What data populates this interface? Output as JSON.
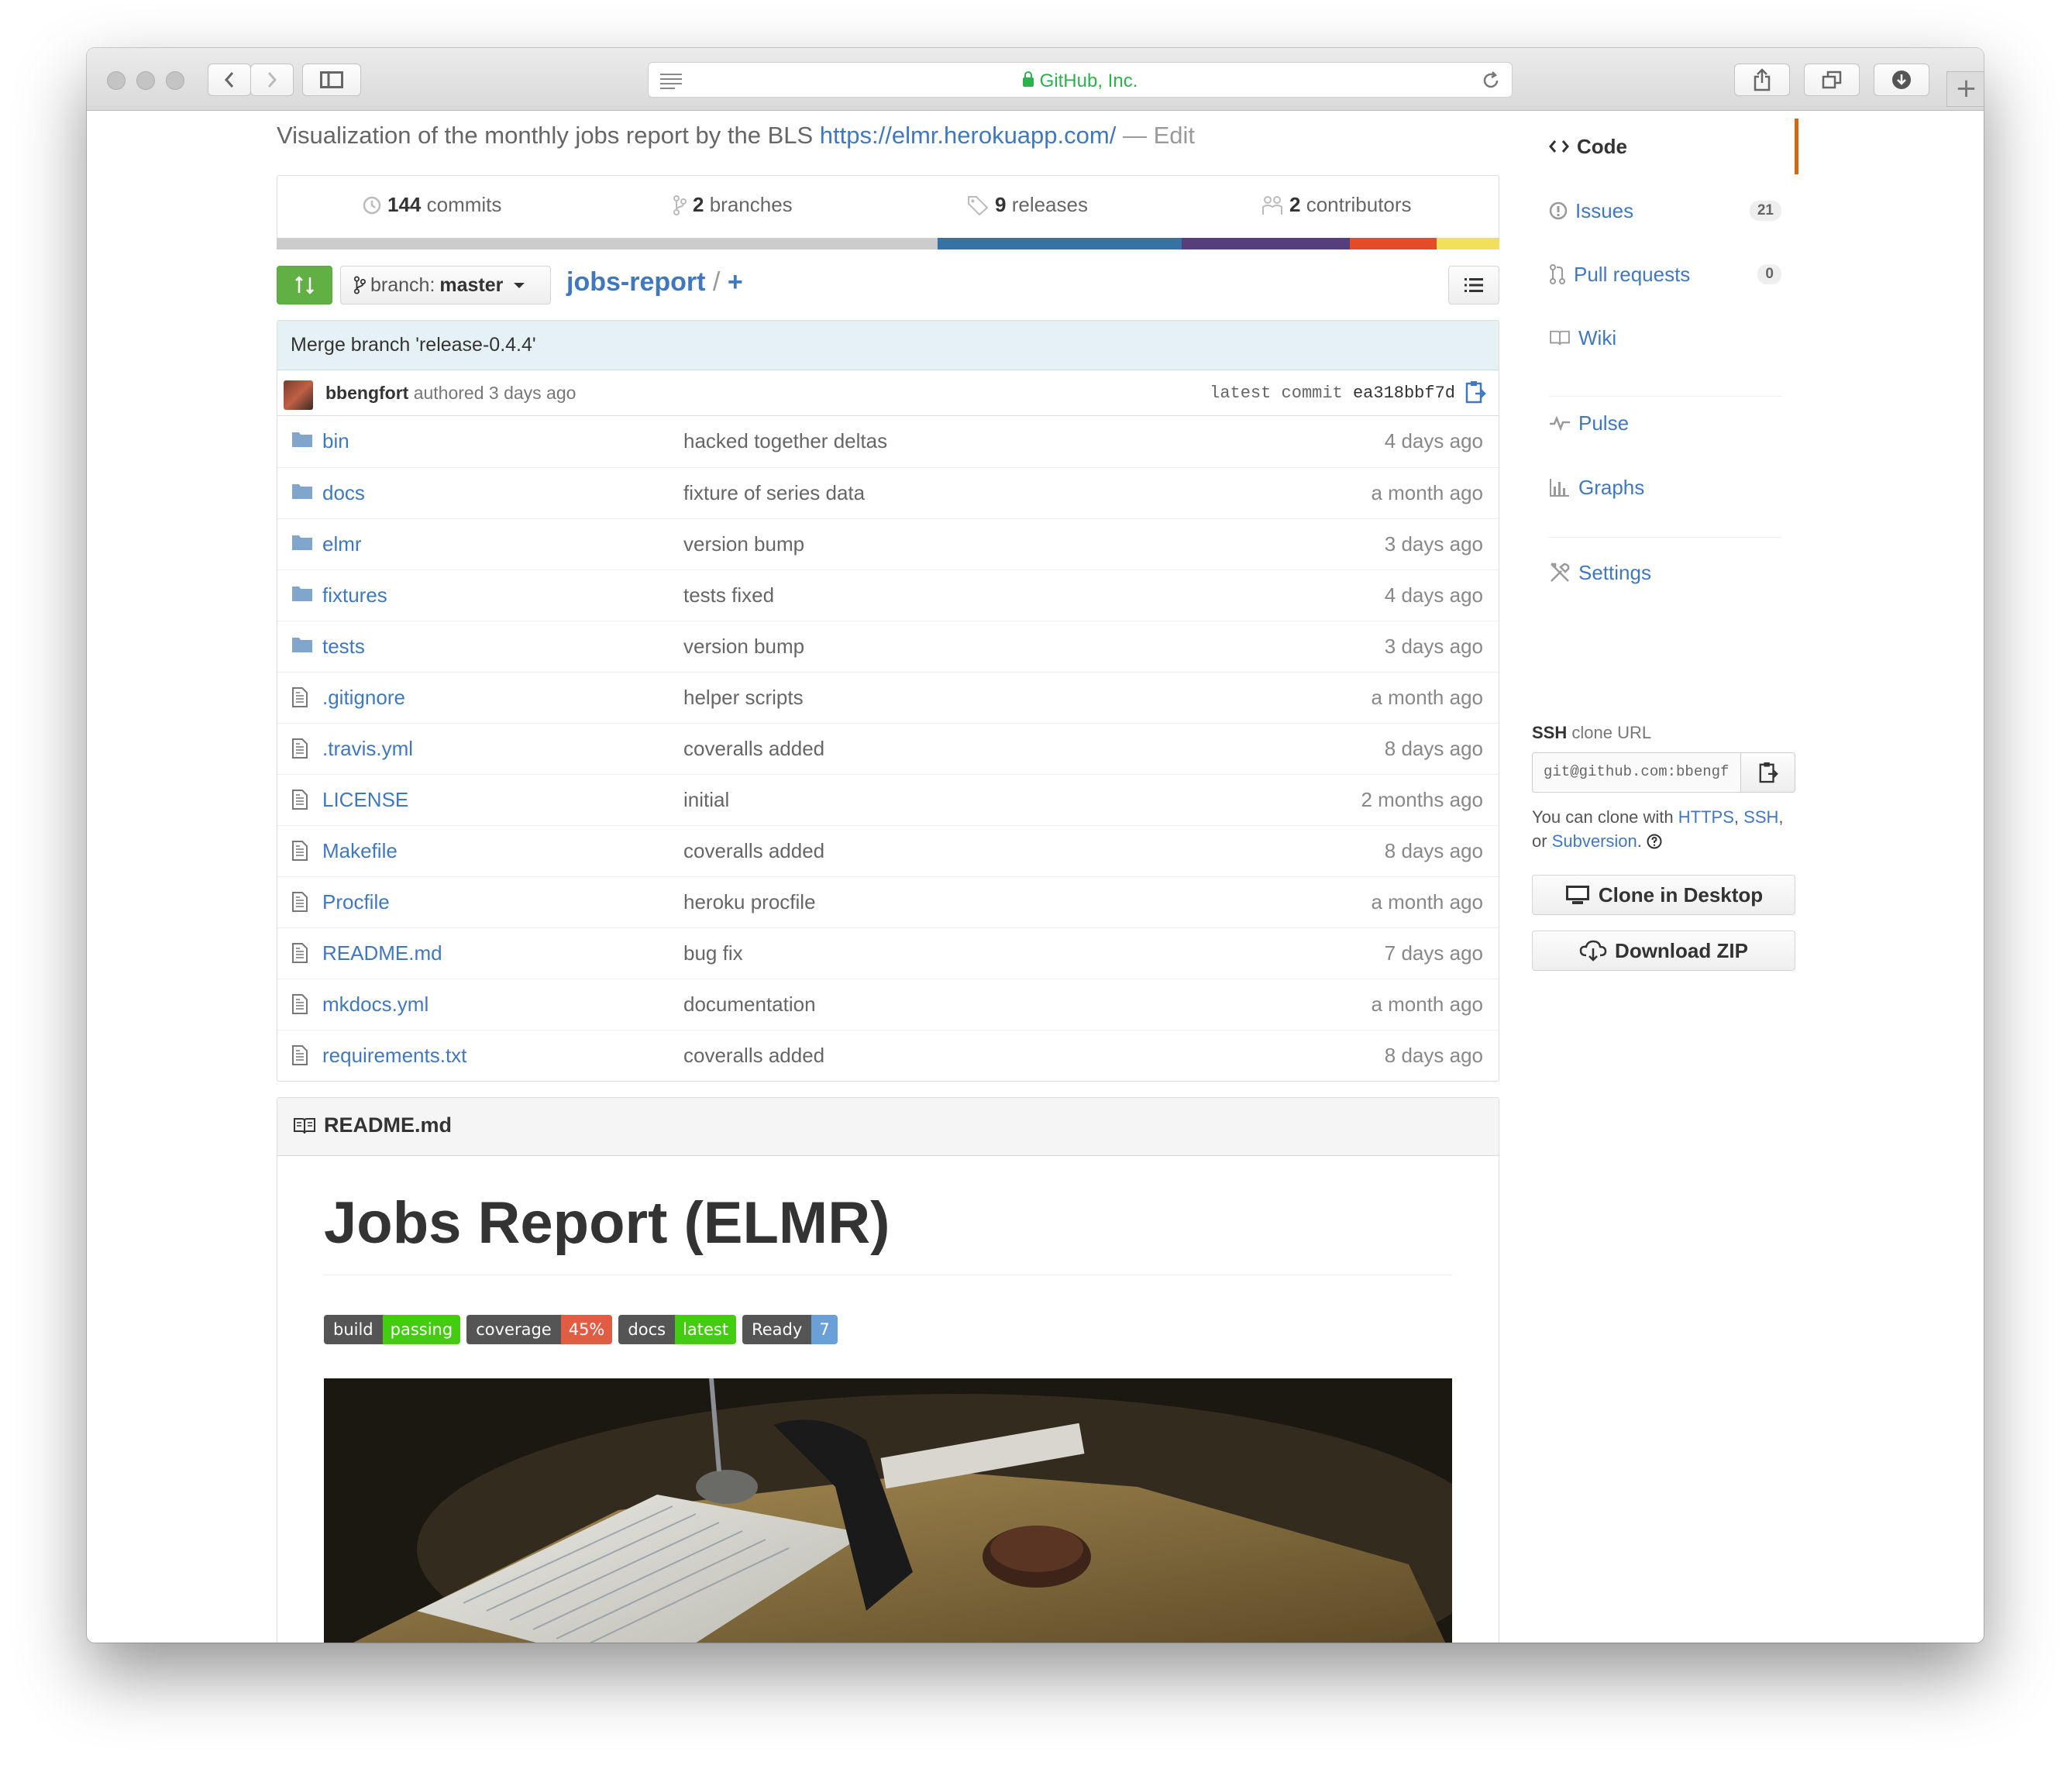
{
  "browser": {
    "site_title": "GitHub, Inc."
  },
  "repo": {
    "description": "Visualization of the monthly jobs report by the BLS",
    "homepage": "https://elmr.herokuapp.com/",
    "edit_label": "— Edit",
    "summary": {
      "commits_count": "144",
      "commits_label": "commits",
      "branches_count": "2",
      "branches_label": "branches",
      "releases_count": "9",
      "releases_label": "releases",
      "contributors_count": "2",
      "contributors_label": "contributors"
    },
    "language_colors": [
      "#cccccc",
      "#3572a5",
      "#563d7c",
      "#e34c26",
      "#f1e05a"
    ],
    "branch_label": "branch:",
    "branch_name": "master",
    "repo_name": "jobs-report",
    "crumb_sep": "/",
    "crumb_add": "+"
  },
  "latest_commit": {
    "message": "Merge branch 'release-0.4.4'",
    "author": "bbengfort",
    "authored": "authored 3 days ago",
    "sha_label": "latest commit",
    "sha": "ea318bbf7d"
  },
  "files": [
    {
      "type": "dir",
      "name": "bin",
      "message": "hacked together deltas",
      "age": "4 days ago"
    },
    {
      "type": "dir",
      "name": "docs",
      "message": "fixture of series data",
      "age": "a month ago"
    },
    {
      "type": "dir",
      "name": "elmr",
      "message": "version bump",
      "age": "3 days ago"
    },
    {
      "type": "dir",
      "name": "fixtures",
      "message": "tests fixed",
      "age": "4 days ago"
    },
    {
      "type": "dir",
      "name": "tests",
      "message": "version bump",
      "age": "3 days ago"
    },
    {
      "type": "file",
      "name": ".gitignore",
      "message": "helper scripts",
      "age": "a month ago"
    },
    {
      "type": "file",
      "name": ".travis.yml",
      "message": "coveralls added",
      "age": "8 days ago"
    },
    {
      "type": "file",
      "name": "LICENSE",
      "message": "initial",
      "age": "2 months ago"
    },
    {
      "type": "file",
      "name": "Makefile",
      "message": "coveralls added",
      "age": "8 days ago"
    },
    {
      "type": "file",
      "name": "Procfile",
      "message": "heroku procfile",
      "age": "a month ago"
    },
    {
      "type": "file",
      "name": "README.md",
      "message": "bug fix",
      "age": "7 days ago"
    },
    {
      "type": "file",
      "name": "mkdocs.yml",
      "message": "documentation",
      "age": "a month ago"
    },
    {
      "type": "file",
      "name": "requirements.txt",
      "message": "coveralls added",
      "age": "8 days ago"
    }
  ],
  "readme": {
    "filename": "README.md",
    "title": "Jobs Report (ELMR)",
    "badges": [
      {
        "left": "build",
        "right": "passing",
        "color": "#4c1"
      },
      {
        "left": "coverage",
        "right": "45%",
        "color": "#e05d44"
      },
      {
        "left": "docs",
        "right": "latest",
        "color": "#4c1"
      },
      {
        "left": "Ready",
        "right": "7",
        "color": "#6aa0d8"
      }
    ]
  },
  "sidebar": {
    "nav": [
      {
        "label": "Code",
        "icon": "code-icon",
        "selected": true
      },
      {
        "label": "Issues",
        "icon": "issue-icon",
        "count": "21"
      },
      {
        "label": "Pull requests",
        "icon": "pull-request-icon",
        "count": "0"
      },
      {
        "label": "Wiki",
        "icon": "book-icon"
      },
      {
        "label": "Pulse",
        "icon": "pulse-icon"
      },
      {
        "label": "Graphs",
        "icon": "graph-icon"
      },
      {
        "label": "Settings",
        "icon": "tools-icon"
      }
    ],
    "clone": {
      "protocol": "SSH",
      "label": "clone URL",
      "url": "git@github.com:bbengfort/jobs-report.git",
      "help_prefix": "You can clone with",
      "https": "HTTPS",
      "ssh": "SSH",
      "or": "or",
      "subversion": "Subversion",
      "help_icon": "question-icon"
    },
    "clone_desktop": "Clone in Desktop",
    "download_zip": "Download ZIP"
  }
}
